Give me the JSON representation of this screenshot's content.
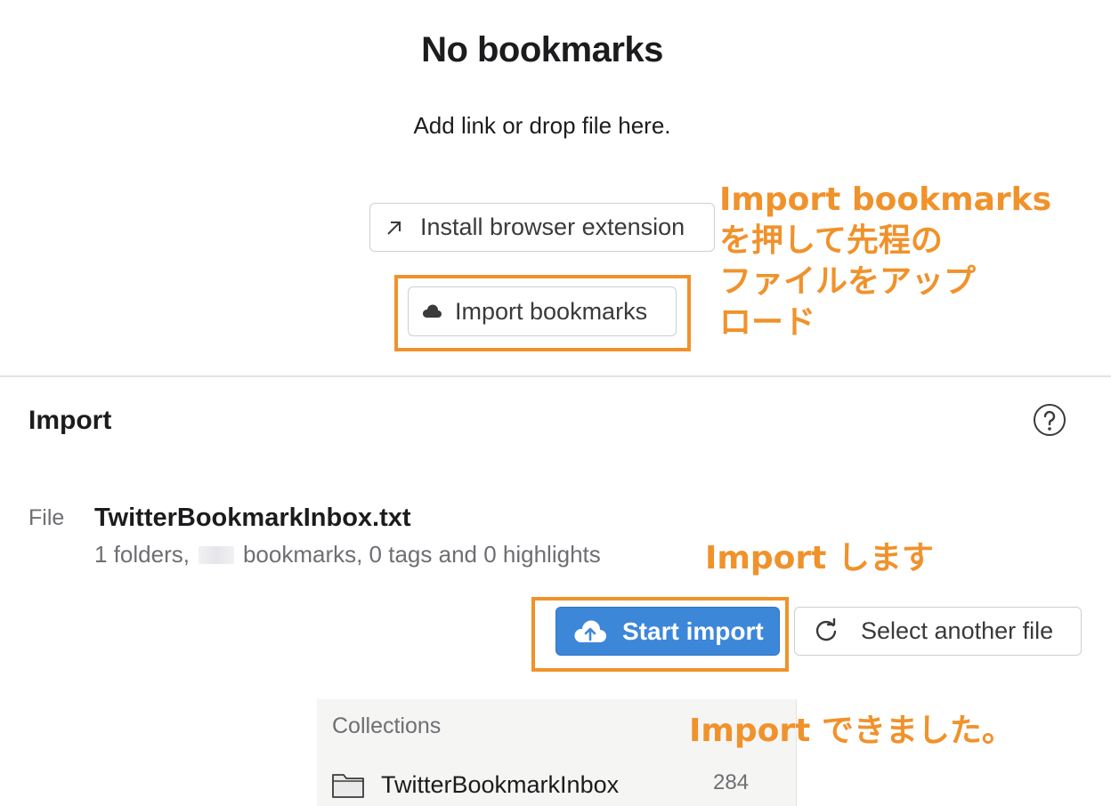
{
  "empty_state": {
    "title": "No bookmarks",
    "subtitle": "Add link or drop file here.",
    "install_extension_label": "Install browser extension",
    "import_bookmarks_label": "Import bookmarks"
  },
  "annotations": {
    "note1": "Import bookmarks\nを押して先程の\nファイルをアップ\nロード",
    "note2": "Import します",
    "note3": "Import できました。",
    "highlight_color": "#f0922b"
  },
  "import_section": {
    "title": "Import",
    "file_label": "File",
    "file_name": "TwitterBookmarkInbox.txt",
    "meta_prefix": "1 folders,",
    "meta_suffix": "bookmarks, 0 tags and 0 highlights",
    "start_import_label": "Start import",
    "select_another_label": "Select another file"
  },
  "collections": {
    "header": "Collections",
    "items": [
      {
        "name": "TwitterBookmarkInbox",
        "count": "284"
      }
    ]
  },
  "colors": {
    "primary_button": "#3d87d9",
    "accent": "#f0922b"
  },
  "icons": {
    "external_link": "arrow-up-right-icon",
    "cloud": "cloud-icon",
    "help": "help-circle-icon",
    "upload": "cloud-upload-icon",
    "refresh": "refresh-icon",
    "folder": "folder-icon"
  }
}
